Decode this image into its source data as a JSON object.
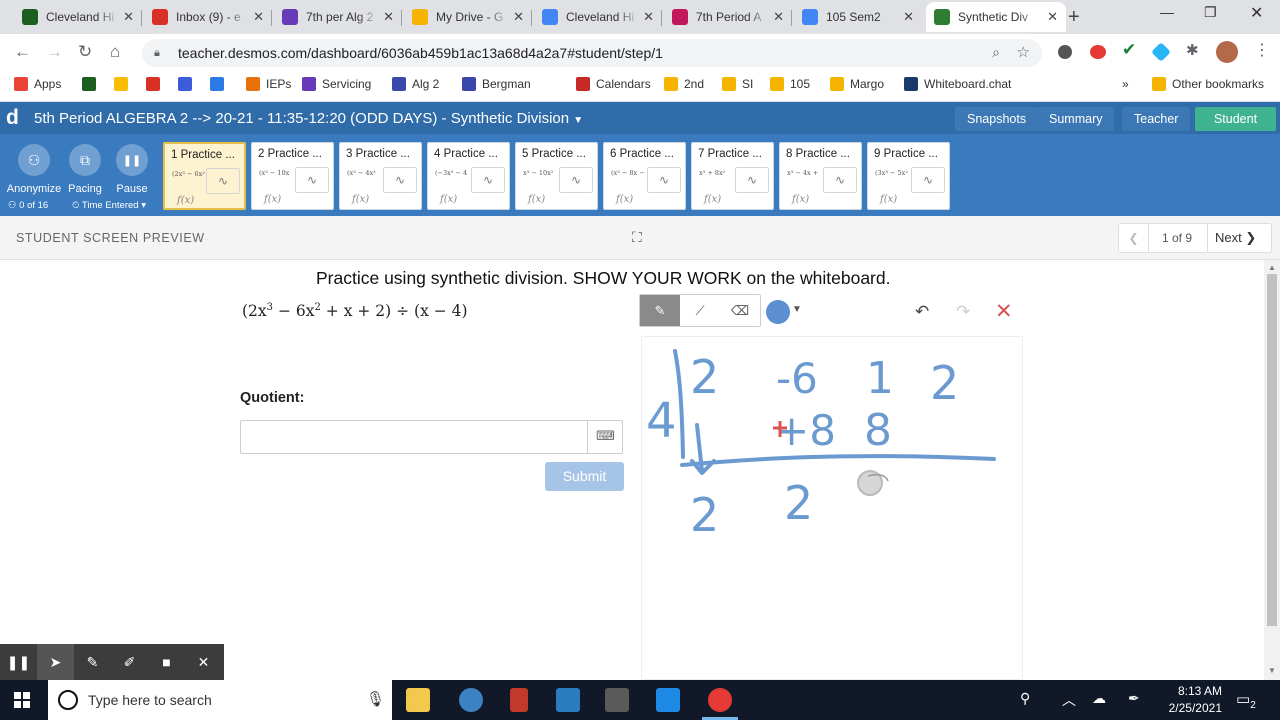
{
  "browser": {
    "tabs": [
      {
        "label": "Cleveland Hi",
        "color": "#1b5e20"
      },
      {
        "label": "Inbox (9) - e",
        "color": "#d93025"
      },
      {
        "label": "7th per Alg 2",
        "color": "#673ab7"
      },
      {
        "label": "My Drive - G",
        "color": "#f4b400"
      },
      {
        "label": "Cleveland Hi",
        "color": "#4285f4"
      },
      {
        "label": "7th Period A",
        "color": "#c2185b"
      },
      {
        "label": "105 Sem2",
        "color": "#4285f4"
      },
      {
        "label": "Synthetic Div",
        "color": "#2e7d32"
      }
    ],
    "new_tab": "+",
    "url": "teacher.desmos.com/dashboard/6036ab459b1ac13a68d4a2a7#student/step/1"
  },
  "bookmarks": {
    "items": [
      {
        "label": "Apps",
        "color": "#ea4335"
      },
      {
        "label": "",
        "color": "#1b5e20"
      },
      {
        "label": "",
        "color": "#fbbc04"
      },
      {
        "label": "",
        "color": "#d93025"
      },
      {
        "label": "",
        "color": "#3b5bdb"
      },
      {
        "label": "",
        "color": "#2c7be5"
      },
      {
        "label": "IEPs",
        "color": "#e8710a"
      },
      {
        "label": "Servicing",
        "color": "#673ab7"
      },
      {
        "label": "Alg 2",
        "color": "#3949ab"
      },
      {
        "label": "Bergman",
        "color": "#3949ab"
      },
      {
        "label": "Calendars",
        "color": "#c62828"
      },
      {
        "label": "2nd",
        "color": "#f4b400"
      },
      {
        "label": "SI",
        "color": "#f4b400"
      },
      {
        "label": "105",
        "color": "#f4b400"
      },
      {
        "label": "Margo",
        "color": "#f4b400"
      },
      {
        "label": "Whiteboard.chat",
        "color": "#1a3a6b"
      }
    ],
    "more": "»",
    "other": "Other bookmarks"
  },
  "desmos": {
    "logo": "d",
    "title": "5th Period ALGEBRA 2 --> 20-21 - 11:35-12:20 (ODD DAYS) - Synthetic Division",
    "view_buttons": [
      "Snapshots",
      "Summary",
      "Teacher",
      "Student"
    ],
    "controls": [
      {
        "label": "Anonymize",
        "icon": "anonymize-icon",
        "glyph": "⚇"
      },
      {
        "label": "Pacing",
        "icon": "pacing-icon",
        "glyph": "⧉"
      },
      {
        "label": "Pause",
        "icon": "pause-icon",
        "glyph": "❚❚"
      }
    ],
    "student_count": "0 of 16",
    "sort": "Time Entered",
    "screens": [
      {
        "title": "1 Practice ...",
        "math": "(2x³ − 6x²",
        "fx": "f(x)"
      },
      {
        "title": "2 Practice ...",
        "math": "(x³ − 10x",
        "fx": "f(x)"
      },
      {
        "title": "3 Practice ...",
        "math": "(x³ − 4x²",
        "fx": "f(x)"
      },
      {
        "title": "4 Practice ...",
        "math": "(−3x³ − 4",
        "fx": "f(x)"
      },
      {
        "title": "5 Practice ...",
        "math": "x³ − 10x²",
        "fx": "f(x)"
      },
      {
        "title": "6 Practice ...",
        "math": "(x³ − 8x −",
        "fx": "f(x)"
      },
      {
        "title": "7 Practice ...",
        "math": "x³ + 8x²",
        "fx": "f(x)"
      },
      {
        "title": "8 Practice ...",
        "math": "x³ − 4x +",
        "fx": "f(x)"
      },
      {
        "title": "9 Practice ...",
        "math": "(3x³ − 5x²",
        "fx": "f(x)"
      }
    ],
    "preview_label": "STUDENT SCREEN PREVIEW",
    "pager": {
      "current": "1 of 9",
      "next": "Next"
    }
  },
  "screen": {
    "instruction": "Practice using synthetic division. SHOW YOUR WORK on the whiteboard.",
    "expression": {
      "p1": "(2x",
      "e1": "3",
      "p2": " − 6x",
      "e2": "2",
      "p3": " + x + 2) ÷ (x − 4)"
    },
    "quotient_label": "Quotient:",
    "quotient_value": "",
    "submit": "Submit",
    "whiteboard": {
      "pen_color": "#5b8fcf",
      "glyphs": [
        {
          "id": "divisor",
          "text": "4"
        },
        {
          "id": "c1",
          "text": "2"
        },
        {
          "id": "c2",
          "text": "-6"
        },
        {
          "id": "c3",
          "text": "1"
        },
        {
          "id": "c4",
          "text": "2"
        },
        {
          "id": "m1",
          "text": "+8"
        },
        {
          "id": "m2",
          "text": "8"
        },
        {
          "id": "r1",
          "text": "2"
        },
        {
          "id": "r2",
          "text": "2"
        }
      ]
    }
  },
  "annotation_toolbar": [
    "pause",
    "pointer",
    "pen",
    "highlighter",
    "camera",
    "close"
  ],
  "taskbar": {
    "search_placeholder": "Type here to search",
    "time": "8:13 AM",
    "date": "2/25/2021",
    "notifications": "2"
  }
}
